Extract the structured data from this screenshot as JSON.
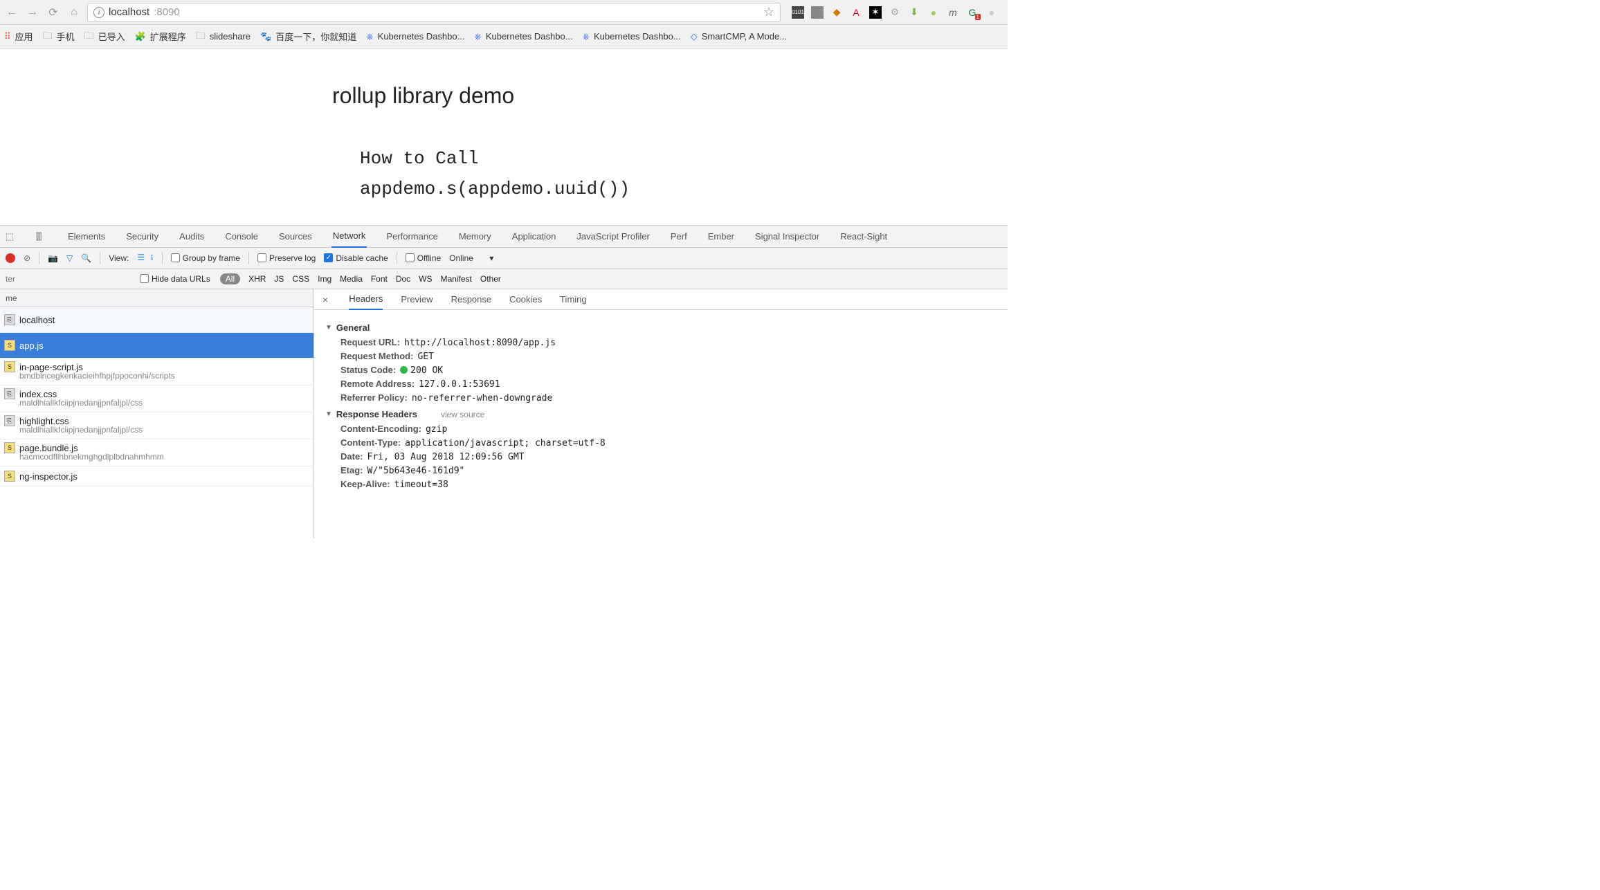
{
  "browser": {
    "url_host": "localhost",
    "url_port": ":8090",
    "extensions": [
      "bin",
      "lap",
      "ng",
      "A",
      "col",
      "lnk",
      "dl",
      "grn",
      "m",
      "G",
      "gr"
    ]
  },
  "bookmarks": [
    {
      "icon": "apps",
      "label": "应用"
    },
    {
      "icon": "folder",
      "label": "手机"
    },
    {
      "icon": "folder",
      "label": "已导入"
    },
    {
      "icon": "puzzle",
      "label": "扩展程序"
    },
    {
      "icon": "folder",
      "label": "slideshare"
    },
    {
      "icon": "baidu",
      "label": "百度一下，你就知道"
    },
    {
      "icon": "k8s",
      "label": "Kubernetes Dashbo..."
    },
    {
      "icon": "k8s",
      "label": "Kubernetes Dashbo..."
    },
    {
      "icon": "k8s",
      "label": "Kubernetes Dashbo..."
    },
    {
      "icon": "smartcmp",
      "label": "SmartCMP, A Mode..."
    }
  ],
  "page": {
    "title": "rollup library demo",
    "code_line1": "How to Call",
    "code_line2": "appdemo.s(appdemo.uuid())"
  },
  "devtools": {
    "tabs": [
      "Elements",
      "Security",
      "Audits",
      "Console",
      "Sources",
      "Network",
      "Performance",
      "Memory",
      "Application",
      "JavaScript Profiler",
      "Perf",
      "Ember",
      "Signal Inspector",
      "React-Sight"
    ],
    "active_tab": "Network",
    "network_toolbar": {
      "view_label": "View:",
      "group_by_frame": "Group by frame",
      "preserve_log": "Preserve log",
      "disable_cache": "Disable cache",
      "offline": "Offline",
      "online": "Online"
    },
    "filter": {
      "placeholder": "ter",
      "hide_data_urls": "Hide data URLs",
      "types": [
        "All",
        "XHR",
        "JS",
        "CSS",
        "Img",
        "Media",
        "Font",
        "Doc",
        "WS",
        "Manifest",
        "Other"
      ]
    },
    "requests": {
      "header": "me",
      "items": [
        {
          "name": "localhost",
          "type": "doc",
          "sub": null
        },
        {
          "name": "app.js",
          "type": "js",
          "sub": null,
          "selected": true
        },
        {
          "name": "in-page-script.js",
          "type": "js",
          "sub": "bmdblncegkenkacieihfhpjfppoconhi/scripts"
        },
        {
          "name": "index.css",
          "type": "css",
          "sub": "maldlhiallkfciipjnedanjjpnfaljpl/css"
        },
        {
          "name": "highlight.css",
          "type": "css",
          "sub": "maldlhiallkfciipjnedanjjpnfaljpl/css"
        },
        {
          "name": "page.bundle.js",
          "type": "js",
          "sub": "hacmcodfllhbnekmghgdlplbdnahmhmm"
        },
        {
          "name": "ng-inspector.js",
          "type": "js",
          "sub": null
        }
      ]
    },
    "detail": {
      "tabs": [
        "Headers",
        "Preview",
        "Response",
        "Cookies",
        "Timing"
      ],
      "active": "Headers",
      "general_label": "General",
      "general": [
        {
          "k": "Request URL:",
          "v": "http://localhost:8090/app.js"
        },
        {
          "k": "Request Method:",
          "v": "GET"
        },
        {
          "k": "Status Code:",
          "v": "200 OK",
          "status": true
        },
        {
          "k": "Remote Address:",
          "v": "127.0.0.1:53691"
        },
        {
          "k": "Referrer Policy:",
          "v": "no-referrer-when-downgrade"
        }
      ],
      "response_headers_label": "Response Headers",
      "view_source": "view source",
      "response_headers": [
        {
          "k": "Content-Encoding:",
          "v": "gzip"
        },
        {
          "k": "Content-Type:",
          "v": "application/javascript; charset=utf-8"
        },
        {
          "k": "Date:",
          "v": "Fri, 03 Aug 2018 12:09:56 GMT"
        },
        {
          "k": "Etag:",
          "v": "W/\"5b643e46-161d9\""
        },
        {
          "k": "Keep-Alive:",
          "v": "timeout=38"
        }
      ]
    }
  }
}
